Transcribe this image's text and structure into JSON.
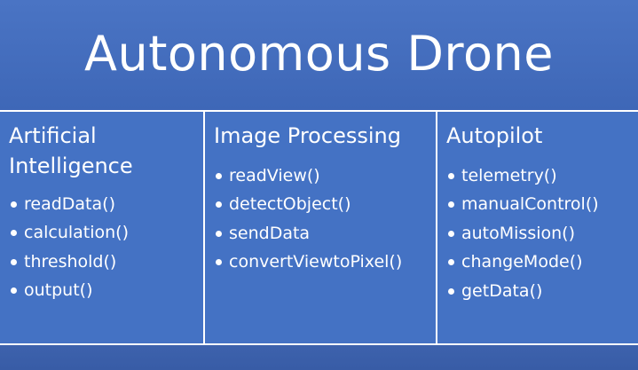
{
  "title": "Autonomous Drone",
  "columns": [
    {
      "heading": "Artificial Intelligence",
      "items": [
        "readData()",
        "calculation()",
        "threshold()",
        "output()"
      ]
    },
    {
      "heading": "Image Processing",
      "items": [
        "readView()",
        "detectObject()",
        "sendData",
        "convertViewtoPixel()"
      ]
    },
    {
      "heading": "Autopilot",
      "items": [
        "telemetry()",
        "manualControl()",
        "autoMission()",
        "changeMode()",
        "getData()"
      ]
    }
  ],
  "colors": {
    "background": "#3a62b3",
    "cell": "#4472c4",
    "text": "#ffffff"
  }
}
